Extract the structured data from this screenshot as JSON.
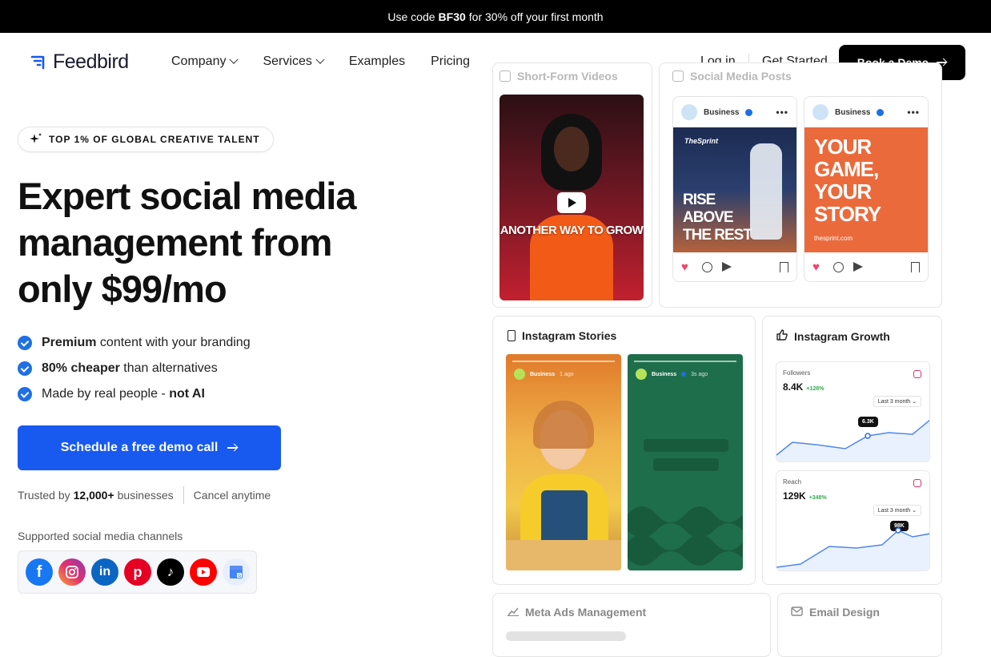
{
  "promo": {
    "prefix": "Use code",
    "code": "BF30",
    "suffix": "for 30% off your first month"
  },
  "nav": {
    "logo": "Feedbird",
    "menu": [
      "Company",
      "Services",
      "Examples",
      "Pricing"
    ],
    "login": "Log in",
    "get_started": "Get Started",
    "book_demo": "Book a Demo"
  },
  "hero": {
    "badge": "TOP 1% OF GLOBAL CREATIVE TALENT",
    "headline": "Expert social media management from only $99/mo",
    "bullets": [
      {
        "bold": "Premium",
        "rest": "content with your branding"
      },
      {
        "bold": "80% cheaper",
        "rest": "than alternatives"
      },
      {
        "pre": "Made by real people - ",
        "bold": "not AI"
      }
    ],
    "cta": "Schedule a free demo call",
    "trust_prefix": "Trusted by",
    "trust_count": "12,000+",
    "trust_suffix": "businesses",
    "cancel": "Cancel anytime",
    "supported": "Supported social media channels",
    "channels": [
      {
        "name": "facebook",
        "glyph": "f",
        "color": "#1877f2"
      },
      {
        "name": "instagram",
        "glyph": "◎",
        "color": "#e1306c"
      },
      {
        "name": "linkedin",
        "glyph": "in",
        "color": "#0a66c2"
      },
      {
        "name": "pinterest",
        "glyph": "p",
        "color": "#e60023"
      },
      {
        "name": "tiktok",
        "glyph": "♪",
        "color": "#000000"
      },
      {
        "name": "youtube",
        "glyph": "▶",
        "color": "#ff0000"
      },
      {
        "name": "google-business",
        "glyph": "G",
        "color": "#4285f4"
      }
    ]
  },
  "collage": {
    "short_form_title": "Short-Form Videos",
    "social_posts_title": "Social Media Posts",
    "video_text": "ANOTHER WAY TO GROW",
    "post1": {
      "account": "Business",
      "brand": "TheSprint",
      "headline": "RISE ABOVE THE REST"
    },
    "post2": {
      "account": "Business",
      "headline": "YOUR GAME, YOUR STORY",
      "url": "thesprint.com"
    },
    "stories_title": "Instagram Stories",
    "story1_account": "Business",
    "story1_time": "1 ago",
    "story2_account": "Business",
    "story2_time": "3s ago",
    "growth_title": "Instagram Growth",
    "followers": {
      "label": "Followers",
      "value": "8.4K",
      "change": "+128%",
      "range": "Last 3 month",
      "tip": "6.3K"
    },
    "reach": {
      "label": "Reach",
      "value": "129K",
      "change": "+348%",
      "range": "Last 3 month",
      "tip": "98K"
    },
    "meta_title": "Meta Ads Management",
    "email_title": "Email Design"
  }
}
